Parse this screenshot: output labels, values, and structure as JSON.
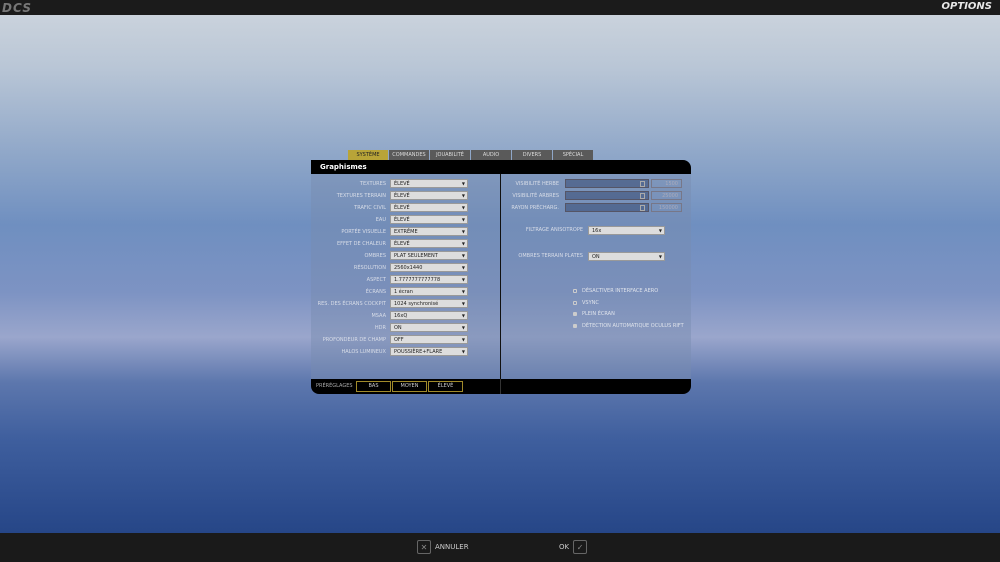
{
  "app": {
    "logo": "DCS",
    "title": "OPTIONS"
  },
  "tabs": [
    {
      "label": "SYSTÈME",
      "active": true
    },
    {
      "label": "COMMANDES"
    },
    {
      "label": "JOUABILITÉ"
    },
    {
      "label": "AUDIO"
    },
    {
      "label": "DIVERS"
    },
    {
      "label": "SPÉCIAL"
    }
  ],
  "panel": {
    "title": "Graphismes",
    "left": [
      {
        "label": "TEXTURES",
        "value": "ÉLEVÉ"
      },
      {
        "label": "TEXTURES TERRAIN",
        "value": "ÉLEVÉ"
      },
      {
        "label": "TRAFIC CIVIL",
        "value": "ÉLEVÉ"
      },
      {
        "label": "EAU",
        "value": "ÉLEVÉ"
      },
      {
        "label": "PORTÉE VISUELLE",
        "value": "EXTRÊME"
      },
      {
        "label": "EFFET DE CHALEUR",
        "value": "ÉLEVÉ"
      },
      {
        "label": "OMBRES",
        "value": "PLAT SEULEMENT"
      },
      {
        "label": "RÉSOLUTION",
        "value": "2560x1440"
      },
      {
        "label": "ASPECT",
        "value": "1.7777777777778"
      },
      {
        "label": "ÉCRANS",
        "value": "1 écran"
      },
      {
        "label": "RES. DES ÉCRANS COCKPIT",
        "value": "1024 synchronisé"
      },
      {
        "label": "MSAA",
        "value": "16xQ"
      },
      {
        "label": "HDR",
        "value": "ON"
      },
      {
        "label": "PROFONDEUR DE CHAMP",
        "value": "OFF"
      },
      {
        "label": "HALOS LUMINEUX",
        "value": "POUSSIÈRE+FLARE"
      }
    ],
    "sliders": [
      {
        "label": "VISIBILITÉ HERBE",
        "value": "1500"
      },
      {
        "label": "VISIBILITÉ ARBRES",
        "value": "25000"
      },
      {
        "label": "RAYON PRÉCHARG.",
        "value": "150000"
      }
    ],
    "anisotropic": {
      "label": "FILTRAGE ANISOTROPE",
      "value": "16x"
    },
    "flat_shadows": {
      "label": "OMBRES TERRAIN PLATES",
      "value": "ON"
    },
    "checkboxes": [
      {
        "label": "DÉSACTIVER INTERFACE AERO",
        "checked": false
      },
      {
        "label": "VSYNC",
        "checked": false
      },
      {
        "label": "PLEIN ÉCRAN",
        "checked": true
      },
      {
        "label": "DÉTECTION AUTOMATIQUE OCULUS RIFT",
        "checked": true
      }
    ],
    "presets": {
      "label": "PRÉRÉGLAGES",
      "buttons": [
        "BAS",
        "MOYEN",
        "ÉLEVÉ"
      ]
    }
  },
  "footer": {
    "cancel": "ANNULER",
    "ok": "OK"
  }
}
